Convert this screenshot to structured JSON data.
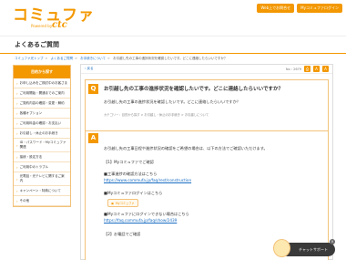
{
  "header": {
    "logo_main": "コミュファ",
    "logo_sub": "Powered by",
    "logo_ctc": "ctc",
    "links": [
      "Web上でお問合せ",
      "Myコミュファログイン"
    ]
  },
  "page_title": "よくあるご質問",
  "breadcrumb": {
    "items": [
      "コミュファ光トップ",
      "よくあるご質問",
      "お手続きについて"
    ],
    "current": "お引越し先の工事の進捗状況を確認したいです。どこに連絡したらいいですか？"
  },
  "sidebar": {
    "heading": "目的から探す",
    "items": [
      "お申し込みをご検討中のお客さま",
      "ご利用開始・開通までのご案内",
      "ご契約内容の確認・変更・解約",
      "各種オプション",
      "ご利用料金の確認・お支払い",
      "お引越し・休止のお手続き",
      "ID・パスワード・Myコミュファ関連",
      "接続・設定方法",
      "ご利用中のトラブル",
      "光電話・光テレビに関するご案内",
      "キャンペーン・特典について",
      "その他"
    ]
  },
  "main": {
    "back_label": "戻る",
    "no_label": "No : 2679",
    "q_badge": "Q",
    "question_title": "お引越し先の工事の進捗状況を確認したいです。どこに連絡したらいいですか？",
    "question_body": "お引越し先の工事の進捗状況を確認したいです。どこに連絡したらいいですか？",
    "question_categories": "カテゴリー：目的から探す > お引越し・休止のお手続き > お引越しについて",
    "a_badge": "A",
    "answer": {
      "intro": "お引越し先の工事日程や進捗状況の確認をご希望の場合は、以下の方法でご確認いただけます。",
      "section1": "【1】Myコミュファでご確認",
      "item1_head": "■工事進捗の確認方法はこちら",
      "item1_link": "https://www.commufa.jp/faq/rest/construction",
      "item2_head": "■Myコミュファログインはこちら",
      "my_btn": "Myコミュファ",
      "item3_head": "■Myコミュファにログインできない場合はこちら",
      "item3_link": "https://faq.commufa.jp/faq/show/2439",
      "section2": "【2】お電話でご確認"
    }
  },
  "chat": {
    "label": "チャットサポート",
    "close": "×"
  },
  "colors": {
    "accent": "#f39800",
    "link": "#1a6dc2"
  }
}
